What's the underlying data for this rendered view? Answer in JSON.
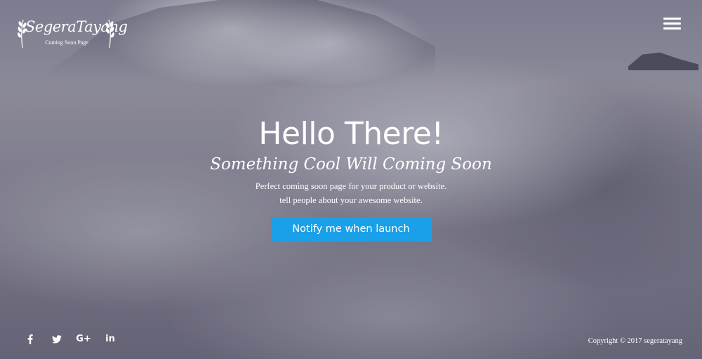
{
  "logo": {
    "name": "SegeraTayang",
    "tagline": "Coming Soon Page"
  },
  "header": {
    "menu_icon": "hamburger-menu-icon"
  },
  "hero": {
    "title": "Hello There!",
    "subtitle": "Something Cool Will Coming Soon",
    "line1": "Perfect coming soon page for your product or website.",
    "line2": "tell people about your awesome website.",
    "button_label": "Notify me when launch",
    "button_color": "#1aa0e8"
  },
  "social": [
    {
      "name": "facebook",
      "icon": "facebook-icon"
    },
    {
      "name": "twitter",
      "icon": "twitter-icon"
    },
    {
      "name": "google-plus",
      "icon": "google-plus-icon",
      "text": "G+"
    },
    {
      "name": "linkedin",
      "icon": "linkedin-icon",
      "text": "in"
    }
  ],
  "footer": {
    "copyright": "Copyright © 2017 segeratayang"
  }
}
